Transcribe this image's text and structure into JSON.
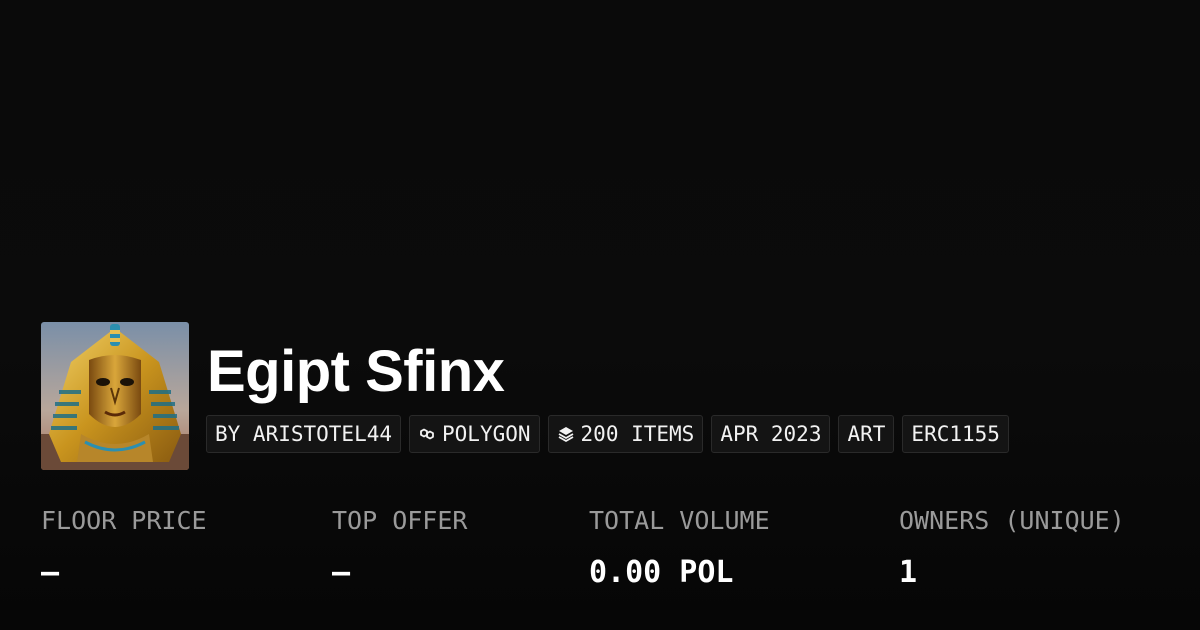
{
  "collection": {
    "title": "Egipt Sfinx",
    "thumbnail_icon": "sphinx-pharaoh-artwork"
  },
  "chips": [
    {
      "label": "BY ARISTOTEL44",
      "icon": ""
    },
    {
      "label": "POLYGON",
      "icon": "polygon-chain-icon"
    },
    {
      "label": "200 ITEMS",
      "icon": "layers-stack-icon"
    },
    {
      "label": "APR 2023",
      "icon": ""
    },
    {
      "label": "ART",
      "icon": ""
    },
    {
      "label": "ERC1155",
      "icon": ""
    }
  ],
  "stats": [
    {
      "label": "FLOOR PRICE",
      "value": "—"
    },
    {
      "label": "TOP OFFER",
      "value": "—"
    },
    {
      "label": "TOTAL VOLUME",
      "value": "0.00 POL"
    },
    {
      "label": "OWNERS (UNIQUE)",
      "value": "1"
    }
  ],
  "colors": {
    "background": "#0a0a0a",
    "chip_bg": "#141414",
    "chip_border": "#2a2a2a",
    "label_gray": "#9a9a9a",
    "text_white": "#ffffff"
  }
}
